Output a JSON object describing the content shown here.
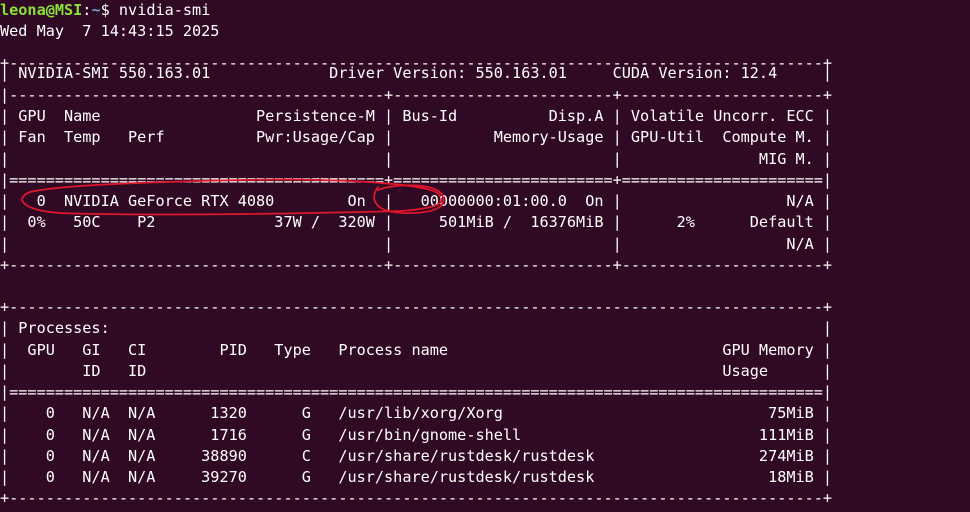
{
  "prompt": {
    "user_host": "leona@MSI",
    "sep": ":",
    "path": "~",
    "dollar": "$ ",
    "command": "nvidia-smi"
  },
  "timestamp": "Wed May  7 14:43:15 2025",
  "colors": {
    "background": "#300a24",
    "text": "#ffffff",
    "prompt_user": "#8ae234",
    "prompt_path": "#729fcf",
    "annotation": "#e0162b"
  },
  "annotation_icons": [
    "red-circle-gpu-name",
    "red-circle-persistence"
  ],
  "lines": [
    "+-----------------------------------------------------------------------------------------+",
    "| NVIDIA-SMI 550.163.01             Driver Version: 550.163.01     CUDA Version: 12.4     |",
    "|-----------------------------------------+------------------------+----------------------+",
    "| GPU  Name                 Persistence-M | Bus-Id          Disp.A | Volatile Uncorr. ECC |",
    "| Fan  Temp   Perf          Pwr:Usage/Cap |           Memory-Usage | GPU-Util  Compute M. |",
    "|                                         |                        |               MIG M. |",
    "|=========================================+========================+======================|",
    "|   0  NVIDIA GeForce RTX 4080        On  |   00000000:01:00.0  On |                  N/A |",
    "|  0%   50C    P2             37W /  320W |     501MiB /  16376MiB |      2%      Default |",
    "|                                         |                        |                  N/A |",
    "+-----------------------------------------+------------------------+----------------------+",
    "",
    "+-----------------------------------------------------------------------------------------+",
    "| Processes:                                                                              |",
    "|  GPU   GI   CI        PID   Type   Process name                              GPU Memory |",
    "|        ID   ID                                                               Usage      |",
    "|=========================================================================================|",
    "|    0   N/A  N/A      1320      G   /usr/lib/xorg/Xorg                             75MiB |",
    "|    0   N/A  N/A      1716      G   /usr/bin/gnome-shell                          111MiB |",
    "|    0   N/A  N/A     38890      C   /usr/share/rustdesk/rustdesk                  274MiB |",
    "|    0   N/A  N/A     39270      G   /usr/share/rustdesk/rustdesk                   18MiB |",
    "+-----------------------------------------------------------------------------------------+"
  ]
}
